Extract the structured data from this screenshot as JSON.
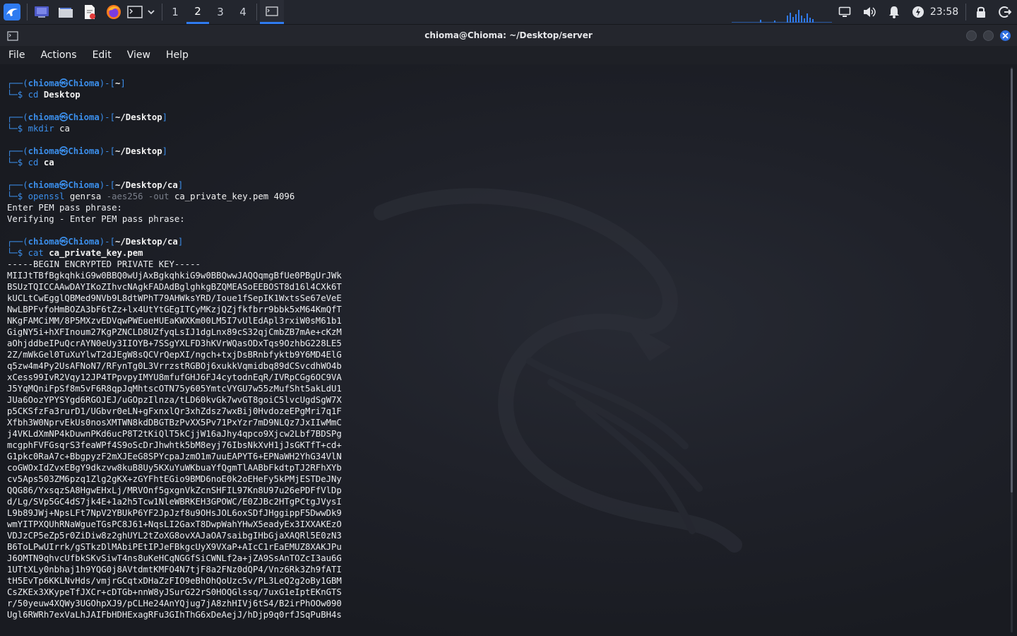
{
  "taskbar": {
    "workspaces": [
      "1",
      "2",
      "3",
      "4"
    ],
    "active_workspace": "2",
    "clock": "23:58",
    "icons": [
      "kali-menu-icon",
      "desktop-icon",
      "file-manager-icon",
      "text-editor-icon",
      "firefox-icon",
      "terminal-icon",
      "chevron-down-icon",
      "window-terminal-icon",
      "network-graph-icon",
      "display-icon",
      "volume-icon",
      "notification-bell-icon",
      "power-manager-icon",
      "lock-icon",
      "logout-icon"
    ]
  },
  "window": {
    "title": "chioma@Chioma: ~/Desktop/server"
  },
  "menu": {
    "file": "File",
    "actions": "Actions",
    "edit": "Edit",
    "view": "View",
    "help": "Help"
  },
  "terminal": {
    "user": "chioma",
    "host": "Chioma",
    "blocks": [
      {
        "path": "~",
        "cmd": "cd",
        "args": [
          {
            "t": "Desktop",
            "style": "argb"
          }
        ]
      },
      {
        "path": "~/Desktop",
        "cmd": "mkdir",
        "args": [
          {
            "t": "ca",
            "style": "arg"
          }
        ]
      },
      {
        "path": "~/Desktop",
        "cmd": "cd",
        "args": [
          {
            "t": "ca",
            "style": "argb"
          }
        ]
      },
      {
        "path": "~/Desktop/ca",
        "cmd": "openssl",
        "args": [
          {
            "t": "genrsa",
            "style": "arg"
          },
          {
            "t": "-aes256",
            "style": "opt"
          },
          {
            "t": "-out",
            "style": "opt"
          },
          {
            "t": "ca_private_key.pem",
            "style": "arg"
          },
          {
            "t": "4096",
            "style": "arg"
          }
        ],
        "output": [
          "Enter PEM pass phrase:",
          "Verifying - Enter PEM pass phrase:"
        ]
      },
      {
        "path": "~/Desktop/ca",
        "cmd": "cat",
        "args": [
          {
            "t": "ca_private_key.pem",
            "style": "argb"
          }
        ],
        "output": [
          "-----BEGIN ENCRYPTED PRIVATE KEY-----",
          "MIIJtTBfBgkqhkiG9w0BBQ0wUjAxBgkqhkiG9w0BBQwwJAQQqmgBfUe0PBgUrJWk",
          "BSUzTQICCAAwDAYIKoZIhvcNAgkFADAdBglghkgBZQMEASoEEBOST8d16l4CXk6T",
          "kUCLtCwEgglQBMed9NVb9L8dtWPhT79AHWksYRD/Ioue1fSepIK1WxtsSe67eVeE",
          "NwLBPFvfoHmBOZA3bF6tZz+lx4UtYtGEgITCyMKzjQZjfkfbrr9bbk5xM64KmQfT",
          "NKgFAMCiMM/8P5MXzvEDVqwPWEueHUEaKWXKm00LM5I7vUlEdApl3rxiW0sM61b1",
          "GigNY5i+hXFInoum27KgPZNCLD8UZfyqLsIJ1dgLnx89cS32qjCmbZB7mAe+cKzM",
          "aOhjddbeIPuQcrAYN0eUy3IIOYB+7SSgYXLFD3hKVrWQasODxTqs9OzhbG228LE5",
          "2Z/mWkGel0TuXuYlwT2dJEgW8sQCVrQepXI/ngch+txjDsBRnbfyktb9Y6MD4ElG",
          "q5zw4m4Py2UsAFNoN7/RFynTg0L3VrrzstRGBOj6xukkVqmidbq89dCSvcdhWO4b",
          "xCess99IvR2Vqy12JP4TPpvpyIMYU8mfufGHJ6FJ4cytodnEqR/IVRpCGg6OC9VA",
          "J5YqMQniFpSf8m5vF6R8qpJqMhtscOTN75y605YmtcVYGU7w55zMufSht5akLdU1",
          "JUa6OozYPYSYgd6RGOJEJ/uGOpzIlnza/tLD60kvGk7wvGT8goiC5lvcUgdSgW7X",
          "p5CKSfzFa3rurD1/UGbvr0eLN+gFxnxlQr3xhZdsz7wxBij0HvdozeEPgMri7q1F",
          "Xfbh3W0NprvEkUs0nosXMTWN8kdDBGTBzPvXX5Pv71PxYzr7mD9NLQz7JxIIwMmC",
          "j4VKLdXmNP4kDuwnPKd6ucP8T2tKiQlT5kCjjW16aJhy4qpco9Xjcw2Lbf7BDSPg",
          "mcgphFVFGsqrS3feaWPf4S9oScDrJhwhtk5bM8eyj76IbsNkXvH1jJsGKTfT+cd+",
          "G1pkc0RaA7c+BbgpyzF2mXJEeG8SPYcpaJzmO1m7uuEAPYT6+EPNaWH2YhG34VlN",
          "coGWOxIdZvxEBgY9dkzvw8kuB8Uy5KXuYuWKbuaYfQgmTlAABbFkdtpTJ2RFhXYb",
          "cv5Aps503ZM6pzq1Zlg2gKX+zGYFhtEGio9BMD6noE0k2oEHeFy5kPMjESTDeJNy",
          "QQG86/YxsqzSA8HgwEHxLj/MRVOnf5gxgnVkZcnSHFIL97Kn8U97u26ePDFfVlDp",
          "d/Lg/SVp5GC4dS7jk4E+1a2h5Tcw1NleWBRKEH3GPOWC/E0ZJBc2HTgPCtgJVysI",
          "L9b89JWj+NpsLFt7NpV2YBUkP6YF2JpJzf8u9OHsJOL6oxSDfJHggippF5DwwDk9",
          "wmYITPXQUhRNaWgueTGsPC8J61+NqsLI2GaxT8DwpWahYHwX5eadyEx3IXXAKEzO",
          "VDJzCP5eZp5r0ZiDiw8z2ghUYL2tZoXG8ovXAJaOA7saibgIHbGjaXAQRl5E0zN3",
          "B6ToLPwUIrrk/gSTkzDlMAbiPEtIPJeFBkgcUyX9VXaP+AIcC1rEaEMUZ8XAKJPu",
          "J6OMTN9qhvcUfbkSKvSiwT4ns8uKeHCqNGGfSiCWNLf2a+jZA9SsAnTOZcI3au6G",
          "1UTtXLy0nbhaj1h9YQG0j8AVtdmtKMFO4N7tjF8a2FNz0dQP4/Vnz6Rk3Zh9fATI",
          "tH5EvTp6KKLNvHds/vmjrGCqtxDHaZzFIO9eBhOhQoUzc5v/PL3LeQ2g2oBy1GBM",
          "CsZKEx3XKypeTfJXCr+cDTGb+nnW8yJSurG22rS0HOQGlssq/7uxG1eIptEKnGTS",
          "r/50yeuw4XQWy3UGOhpXJ9/pCLHe24AnYQjug7jA8zhHIVj6tS4/B2irPhOOw090",
          "Ugl6RWRh7exVaLhJAIFbHDHExagRFu3GIhThG6xDeAejJ/hDjp9q0rfJSqPuBH4s"
        ]
      }
    ]
  }
}
